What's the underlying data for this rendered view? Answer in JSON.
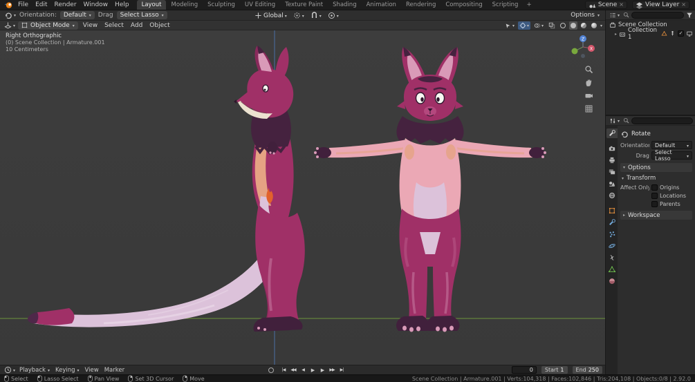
{
  "topbar": {
    "menus": [
      "File",
      "Edit",
      "Render",
      "Window",
      "Help"
    ],
    "tabs": [
      "Layout",
      "Modeling",
      "Sculpting",
      "UV Editing",
      "Texture Paint",
      "Shading",
      "Animation",
      "Rendering",
      "Compositing",
      "Scripting"
    ],
    "active_tab": "Layout",
    "tab_add": "+",
    "scene_label": "Scene",
    "view_layer_label": "View Layer"
  },
  "tool_settings": {
    "orientation_label": "Orientation:",
    "orientation_value": "Default",
    "drag_label": "Drag",
    "drag_value": "Select Lasso",
    "transform_orientation": "Global",
    "options_label": "Options"
  },
  "viewport_header": {
    "mode": "Object Mode",
    "menus": [
      "View",
      "Select",
      "Add",
      "Object"
    ]
  },
  "viewport": {
    "overlay": [
      "Right Orthographic",
      "(0) Scene Collection | Armature.001",
      "10 Centimeters"
    ]
  },
  "outliner": {
    "items": [
      {
        "label": "Scene Collection"
      },
      {
        "label": "Collection 1"
      }
    ]
  },
  "properties": {
    "tool_title": "Rotate",
    "orientation_label": "Orientation:",
    "orientation_value": "Default",
    "drag_label": "Drag",
    "drag_value": "Select Lasso",
    "options_header": "Options",
    "transform_header": "Transform",
    "affect_only_label": "Affect Only",
    "checkboxes": [
      "Origins",
      "Locations",
      "Parents"
    ],
    "workspace_header": "Workspace"
  },
  "timeline": {
    "menus": [
      "Playback",
      "Keying",
      "View",
      "Marker"
    ],
    "transport": [
      "|◀",
      "◀◀",
      "◀",
      "▶",
      "▶",
      "▶▶",
      "▶|"
    ],
    "current_frame": "0",
    "start_label": "Start",
    "start_value": "1",
    "end_label": "End",
    "end_value": "250"
  },
  "statusbar": {
    "hints": [
      "Select",
      "Lasso Select",
      "Pan View",
      "Set 3D Cursor",
      "Move"
    ],
    "stats": "Scene Collection | Armature.001 | Verts:104,318 | Faces:102,846 | Tris:204,108 | Objects:0/8 | 2.92.0"
  },
  "palette": {
    "accent_blue": "#4772b3",
    "floor_line_green": "#6b8e3a",
    "fur_magenta": "#a03067",
    "fur_pink": "#eba8b5",
    "fur_peach": "#e5a383",
    "fur_lavender": "#dcc2da",
    "fur_dark_purple": "#45223f"
  }
}
